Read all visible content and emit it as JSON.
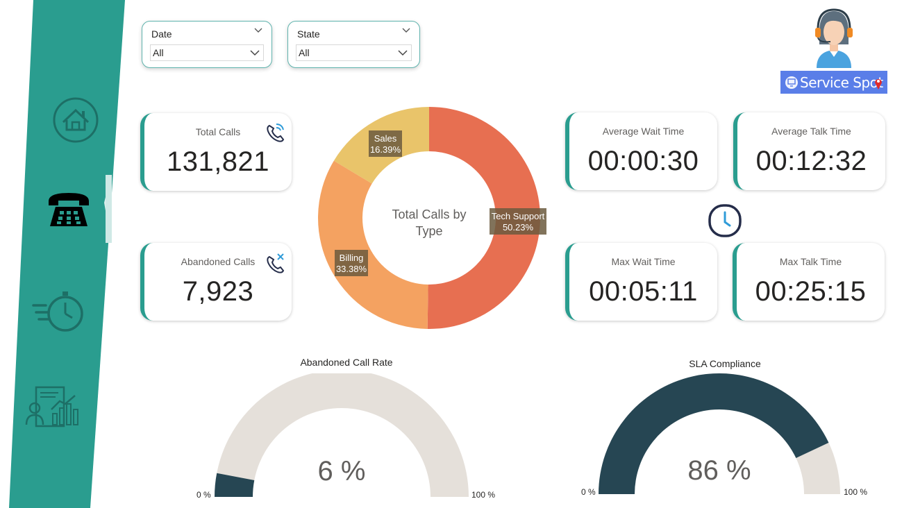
{
  "colors": {
    "sidebar": "#2a9d8f",
    "accent_teal": "#2a9d8f",
    "tech_support": "#e76f51",
    "billing": "#f4a261",
    "sales": "#e9c46a",
    "gauge_fill": "#264653",
    "gauge_track": "#e5e0da"
  },
  "sidebar": {
    "items": [
      {
        "name": "home",
        "icon": "home-icon"
      },
      {
        "name": "calls",
        "icon": "phone-icon",
        "active": true
      },
      {
        "name": "timing",
        "icon": "stopwatch-icon"
      },
      {
        "name": "reports",
        "icon": "report-analytics-icon"
      }
    ]
  },
  "filters": {
    "date": {
      "title": "Date",
      "value": "All"
    },
    "state": {
      "title": "State",
      "value": "All"
    }
  },
  "logo": {
    "text": "Service Spot"
  },
  "kpis": {
    "total_calls": {
      "label": "Total Calls",
      "value": "131,821",
      "icon": "phone-wave-icon"
    },
    "abandoned_calls": {
      "label": "Abandoned Calls",
      "value": "7,923",
      "icon": "phone-missed-icon"
    },
    "avg_wait": {
      "label": "Average Wait Time",
      "value": "00:00:30"
    },
    "avg_talk": {
      "label": "Average Talk Time",
      "value": "00:12:32"
    },
    "max_wait": {
      "label": "Max Wait Time",
      "value": "00:05:11"
    },
    "max_talk": {
      "label": "Max Talk Time",
      "value": "00:25:15"
    },
    "clock_icon": "clock-icon"
  },
  "chart_data": [
    {
      "type": "pie",
      "title": "Total Calls by Type",
      "slices": [
        {
          "label": "Tech Support",
          "value": 50.23,
          "value_label": "50.23%"
        },
        {
          "label": "Billing",
          "value": 33.38,
          "value_label": "33.38%"
        },
        {
          "label": "Sales",
          "value": 16.39,
          "value_label": "16.39%"
        }
      ],
      "donut": true
    },
    {
      "type": "gauge",
      "title": "Abandoned Call Rate",
      "value": 6,
      "value_label": "6 %",
      "min_label": "0 %",
      "max_label": "100 %",
      "range": [
        0,
        100
      ]
    },
    {
      "type": "gauge",
      "title": "SLA Compliance",
      "value": 86,
      "value_label": "86 %",
      "min_label": "0 %",
      "max_label": "100 %",
      "range": [
        0,
        100
      ]
    }
  ]
}
